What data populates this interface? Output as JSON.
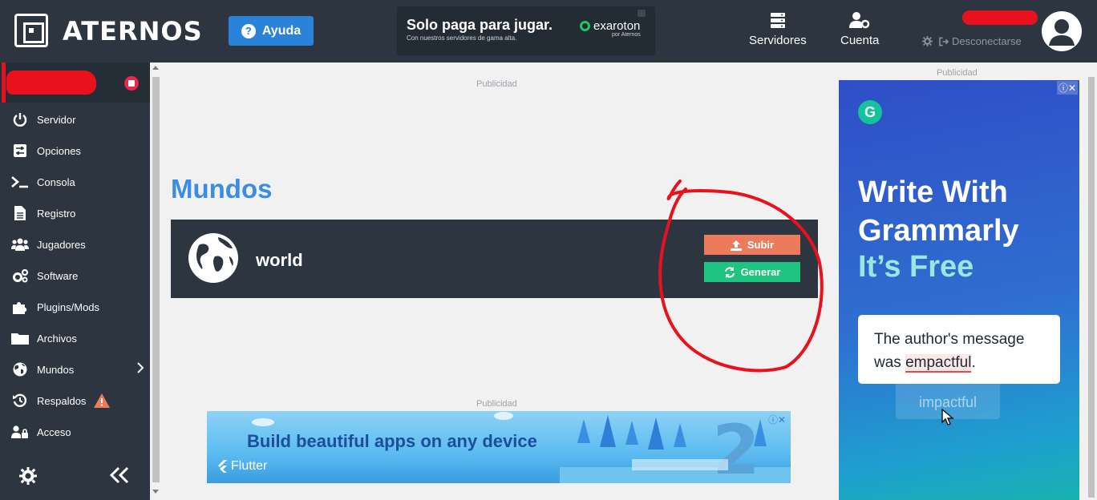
{
  "header": {
    "brand": "ATERNOS",
    "help_label": "Ayuda",
    "ad": {
      "title": "Solo paga para jugar.",
      "subtitle": "Con nuestros servidores de gama alta.",
      "brand": "exaroton",
      "brand_sub": "por Aternos"
    },
    "nav": [
      {
        "label": "Servidores",
        "icon": "server-icon"
      },
      {
        "label": "Cuenta",
        "icon": "user-cog-icon"
      }
    ],
    "logout_label": "Desconectarse"
  },
  "sidebar": {
    "items": [
      {
        "label": "Servidor",
        "icon": "power-icon"
      },
      {
        "label": "Opciones",
        "icon": "sliders-icon"
      },
      {
        "label": "Consola",
        "icon": "terminal-icon"
      },
      {
        "label": "Registro",
        "icon": "file-icon"
      },
      {
        "label": "Jugadores",
        "icon": "users-icon"
      },
      {
        "label": "Software",
        "icon": "cogs-icon"
      },
      {
        "label": "Plugins/Mods",
        "icon": "puzzle-icon"
      },
      {
        "label": "Archivos",
        "icon": "folder-icon"
      },
      {
        "label": "Mundos",
        "icon": "globe-icon"
      },
      {
        "label": "Respaldos",
        "icon": "history-icon"
      },
      {
        "label": "Acceso",
        "icon": "user-lock-icon"
      }
    ]
  },
  "main": {
    "ad_label": "Publicidad",
    "title": "Mundos",
    "world": {
      "name": "world",
      "upload_label": "Subir",
      "generate_label": "Generar"
    }
  },
  "ads": {
    "flutter": {
      "headline": "Build beautiful apps on any device",
      "brand": "Flutter"
    },
    "grammarly": {
      "line1": "Write With",
      "line2": "Grammarly",
      "line3": "It’s Free",
      "sentence_a": "The author's message was ",
      "highlight": "empactful",
      "sentence_end": ".",
      "suggestion": "impactful"
    }
  },
  "colors": {
    "header_bg": "#2c3540",
    "accent_blue": "#3a8de0",
    "upload": "#ec7b5b",
    "generate": "#1ec47f",
    "status_stop": "#e9284b"
  }
}
